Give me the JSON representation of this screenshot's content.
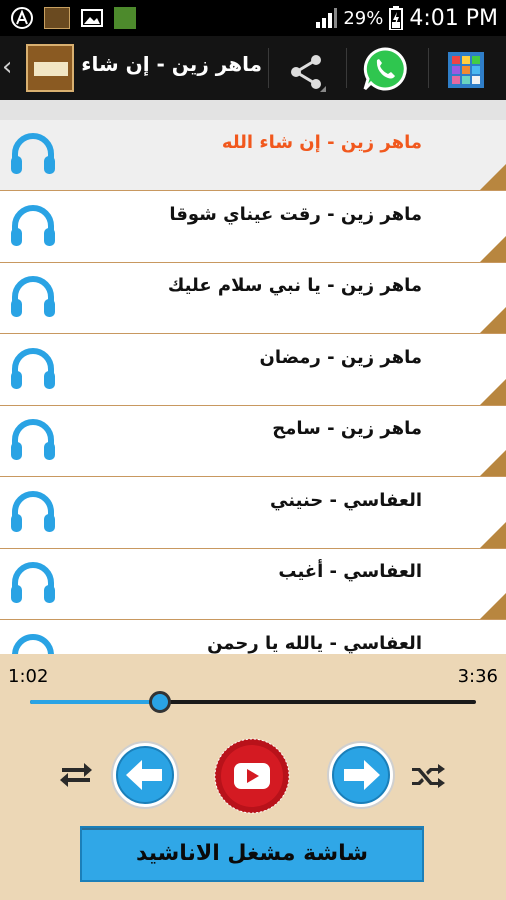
{
  "status_bar": {
    "battery": "29%",
    "time": "4:01 PM"
  },
  "action_bar": {
    "title": "ماهر زين - إن شاء الله",
    "icons": [
      "chevron-left-icon",
      "app-logo-icon",
      "share-icon",
      "whatsapp-icon",
      "grid-icon"
    ]
  },
  "tracks": [
    {
      "title": "ماهر زين - إن شاء الله",
      "active": true
    },
    {
      "title": "ماهر زين - رقت عيناي شوقا",
      "active": false
    },
    {
      "title": "ماهر زين - يا نبي سلام عليك",
      "active": false
    },
    {
      "title": "ماهر زين - رمضان",
      "active": false
    },
    {
      "title": "ماهر زين - سامح",
      "active": false
    },
    {
      "title": "العفاسي - حنيني",
      "active": false
    },
    {
      "title": "العفاسي - أغيب",
      "active": false
    },
    {
      "title": "العفاسي - يالله يا رحمن",
      "active": false
    }
  ],
  "player": {
    "current_time": "1:02",
    "total_time": "3:36",
    "progress": 0.2915,
    "accent": "#2aa3e4",
    "cta_label": "شاشة مشغل الاناشيد"
  }
}
